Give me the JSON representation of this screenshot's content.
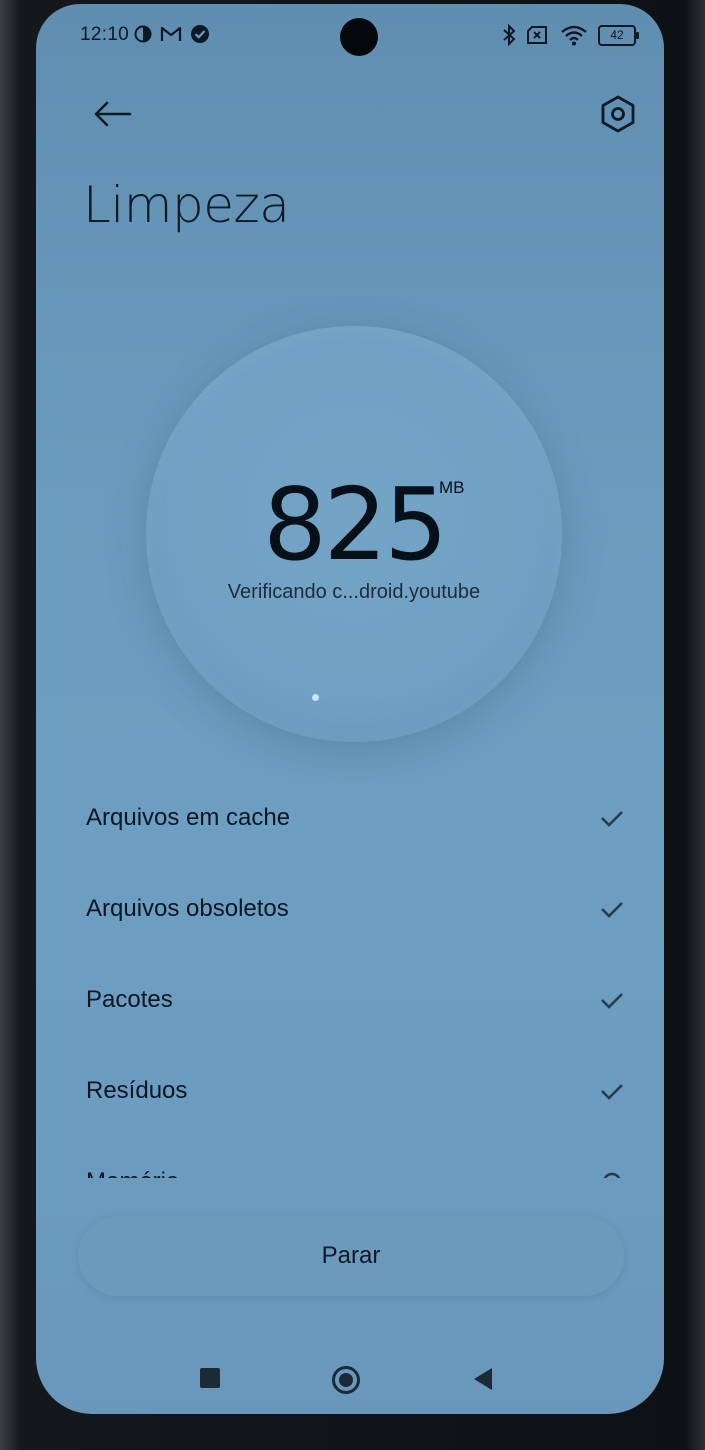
{
  "status_bar": {
    "time": "12:10",
    "battery": "42",
    "icons_left": [
      "data-saver-icon",
      "gmail-icon",
      "verified-icon"
    ],
    "icons_right": [
      "bluetooth-icon",
      "no-sim-icon",
      "wifi-icon",
      "battery-icon"
    ]
  },
  "header": {
    "title": "Limpeza",
    "back_icon": "arrow-left-icon",
    "settings_icon": "settings-hexagon-icon"
  },
  "scan": {
    "value": "825",
    "unit": "MB",
    "status": "Verificando c...droid.youtube"
  },
  "list": {
    "items": [
      {
        "label": "Arquivos em cache",
        "state": "done"
      },
      {
        "label": "Arquivos obsoletos",
        "state": "done"
      },
      {
        "label": "Pacotes",
        "state": "done"
      },
      {
        "label": "Resíduos",
        "state": "done"
      },
      {
        "label": "Memória",
        "state": "scanning"
      }
    ]
  },
  "actions": {
    "stop_label": "Parar"
  },
  "nav": {
    "recents": "recents-icon",
    "home": "home-icon",
    "back": "back-triangle-icon"
  },
  "colors": {
    "screen_bg": "#6b9bbe",
    "text_primary": "#0b1620",
    "button_bg": "#6b9abd"
  }
}
